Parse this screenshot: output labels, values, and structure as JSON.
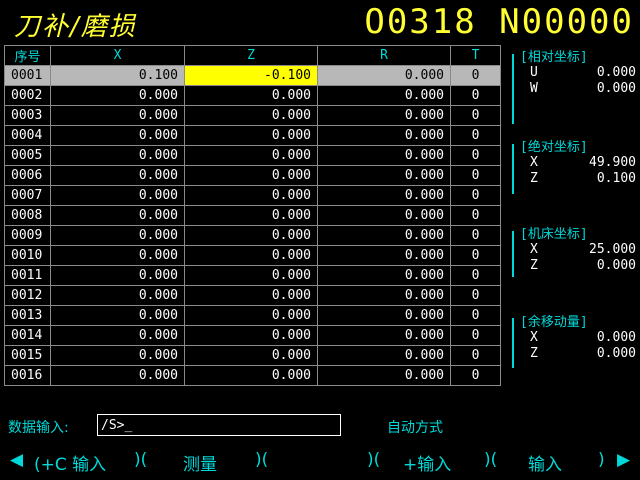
{
  "header": {
    "title": "刀补/磨损",
    "program": "O0318 N00000"
  },
  "table": {
    "columns": [
      "序号",
      "X",
      "Z",
      "R",
      "T"
    ],
    "rows": [
      [
        "0001",
        "0.100",
        "-0.100",
        "0.000",
        "0"
      ],
      [
        "0002",
        "0.000",
        "0.000",
        "0.000",
        "0"
      ],
      [
        "0003",
        "0.000",
        "0.000",
        "0.000",
        "0"
      ],
      [
        "0004",
        "0.000",
        "0.000",
        "0.000",
        "0"
      ],
      [
        "0005",
        "0.000",
        "0.000",
        "0.000",
        "0"
      ],
      [
        "0006",
        "0.000",
        "0.000",
        "0.000",
        "0"
      ],
      [
        "0007",
        "0.000",
        "0.000",
        "0.000",
        "0"
      ],
      [
        "0008",
        "0.000",
        "0.000",
        "0.000",
        "0"
      ],
      [
        "0009",
        "0.000",
        "0.000",
        "0.000",
        "0"
      ],
      [
        "0010",
        "0.000",
        "0.000",
        "0.000",
        "0"
      ],
      [
        "0011",
        "0.000",
        "0.000",
        "0.000",
        "0"
      ],
      [
        "0012",
        "0.000",
        "0.000",
        "0.000",
        "0"
      ],
      [
        "0013",
        "0.000",
        "0.000",
        "0.000",
        "0"
      ],
      [
        "0014",
        "0.000",
        "0.000",
        "0.000",
        "0"
      ],
      [
        "0015",
        "0.000",
        "0.000",
        "0.000",
        "0"
      ],
      [
        "0016",
        "0.000",
        "0.000",
        "0.000",
        "0"
      ]
    ]
  },
  "side": {
    "relative": {
      "title": "[相对坐标]",
      "u_label": "U",
      "u_value": "0.000",
      "w_label": "W",
      "w_value": "0.000"
    },
    "absolute": {
      "title": "[绝对坐标]",
      "x_label": "X",
      "x_value": "49.900",
      "z_label": "Z",
      "z_value": "0.100"
    },
    "machine": {
      "title": "[机床坐标]",
      "x_label": "X",
      "x_value": "25.000",
      "z_label": "Z",
      "z_value": "0.000"
    },
    "distance_to_go": {
      "title": "[余移动量]",
      "x_label": "X",
      "x_value": "0.000",
      "z_label": "Z",
      "z_value": "0.000"
    }
  },
  "input": {
    "label": "数据输入:",
    "value": "/S>_"
  },
  "mode": "自动方式",
  "softkeys": {
    "left_arrow": "◀",
    "k1": "(+C 输入",
    "k1_close": ")(",
    "k2": "测量",
    "k2_close": ")(",
    "k3_open": ")(",
    "k3": "+输入",
    "k4_open": ")(",
    "k4": "输入",
    "k4_close": ")",
    "right_arrow": "▶"
  },
  "colors": {
    "title": "#ffff33",
    "label": "#00d9d9",
    "selected_row": "#b8b8b8",
    "cursor_cell": "#ffff00"
  }
}
